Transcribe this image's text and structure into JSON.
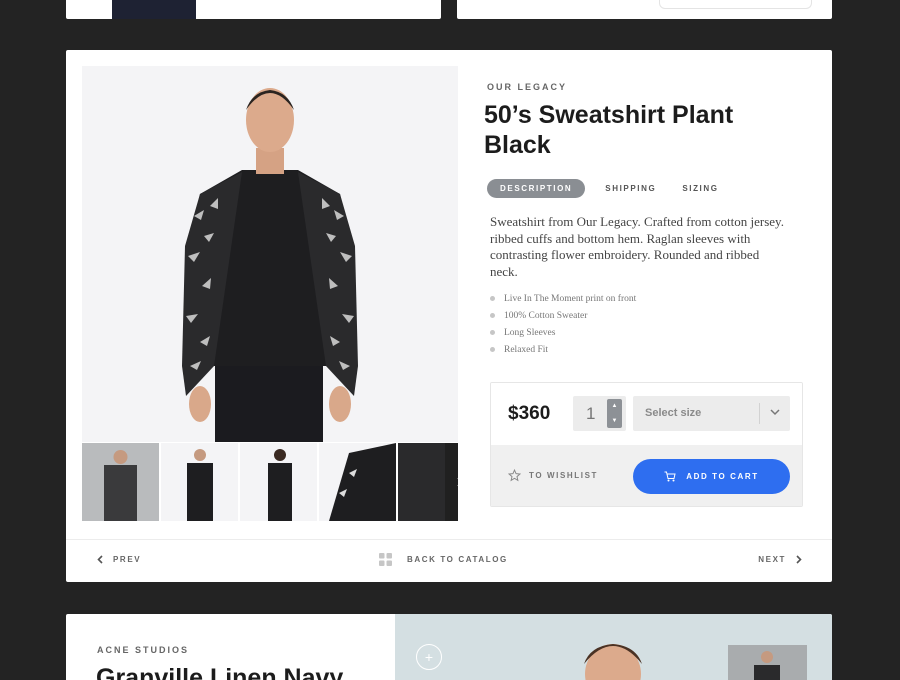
{
  "product": {
    "eyebrow": "OUR LEGACY",
    "title": "50’s Sweatshirt Plant Black",
    "tabs": [
      {
        "label": "DESCRIPTION",
        "active": true
      },
      {
        "label": "SHIPPING",
        "active": false
      },
      {
        "label": "SIZING",
        "active": false
      }
    ],
    "description": "Sweatshirt from Our Legacy. Crafted from cotton jersey. ribbed cuffs and bottom hem. Raglan sleeves with contrasting flower embroidery. Rounded and ribbed neck.",
    "bullets": [
      "Live In The Moment print on front",
      "100% Cotton Sweater",
      "Long Sleeves",
      "Relaxed Fit"
    ],
    "price": "$360",
    "quantity": "1",
    "size_placeholder": "Select size",
    "wishlist_label": "TO WISHLIST",
    "cart_label": "ADD TO CART",
    "accent_color": "#2e6ef0"
  },
  "nav": {
    "prev": "PREV",
    "catalog": "BACK TO CATALOG",
    "next": "NEXT"
  },
  "next_card": {
    "eyebrow": "ACNE STUDIOS",
    "title": "Granville Linen Navy"
  },
  "icons": [
    "star-icon",
    "cart-icon",
    "grid-icon",
    "chevron-left-icon",
    "chevron-right-icon",
    "chevron-down-icon",
    "plus-icon"
  ]
}
